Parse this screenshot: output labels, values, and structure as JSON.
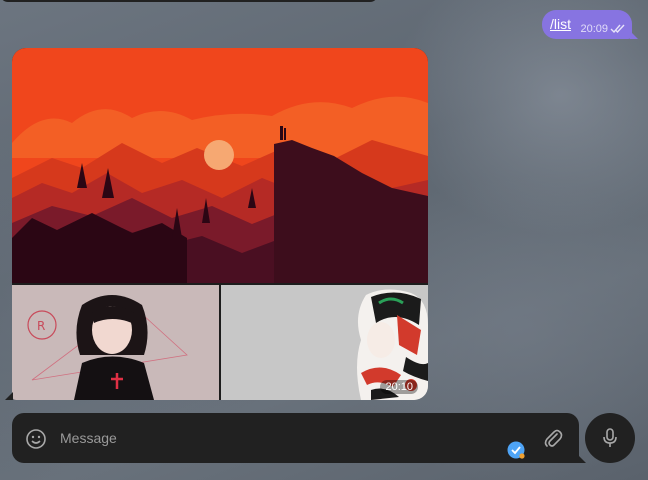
{
  "outgoing_message": {
    "text": "/list",
    "time": "20:09",
    "status_icon": "double-check-icon"
  },
  "album": {
    "photos": [
      {
        "description_icon": "sunset-landscape-image"
      },
      {
        "description_icon": "anime-girl-image"
      },
      {
        "description_icon": "koi-girl-image"
      }
    ],
    "time": "20:10"
  },
  "composer": {
    "placeholder": "Message",
    "emoji_icon": "smile-icon",
    "attach_icon": "paperclip-icon",
    "mic_icon": "microphone-icon"
  },
  "colors": {
    "outgoing_bubble": "#8774e1",
    "panel": "#212121",
    "sky": "#f0461c"
  }
}
